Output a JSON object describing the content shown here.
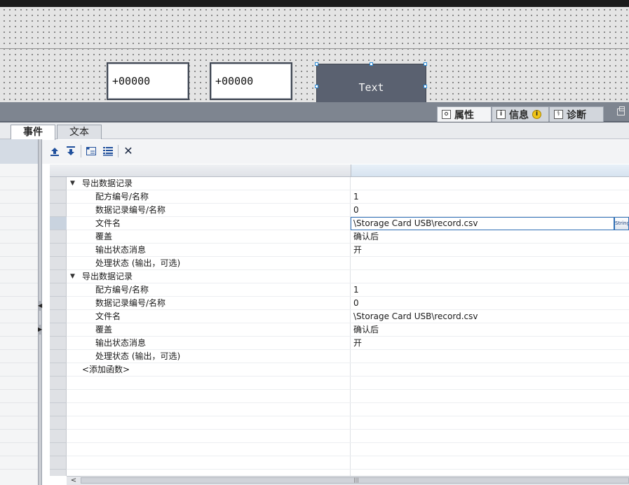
{
  "hmi_canvas": {
    "io_field_1_value": "+00000",
    "io_field_2_value": "+00000",
    "text_button_label": "Text"
  },
  "inspector_tabs": [
    {
      "label": "属性",
      "icon": "properties-icon",
      "active": true
    },
    {
      "label": "信息",
      "icon": "info-icon",
      "badge": "i"
    },
    {
      "label": "诊断",
      "icon": "diagnostics-icon"
    }
  ],
  "property_tabs": [
    {
      "label": "事件",
      "active": true
    },
    {
      "label": "文本"
    }
  ],
  "toolbar": {
    "buttons": [
      "move-up-icon",
      "move-down-icon",
      "insert-function-icon",
      "list-functions-icon",
      "delete-icon"
    ],
    "delete_glyph": "✕"
  },
  "functions": [
    {
      "name": "导出数据记录",
      "params": [
        {
          "name": "配方编号/名称",
          "value": "1"
        },
        {
          "name": "数据记录编号/名称",
          "value": "0"
        },
        {
          "name": "文件名",
          "value": "\\Storage Card USB\\record.csv",
          "editing": true
        },
        {
          "name": "覆盖",
          "value": "确认后"
        },
        {
          "name": "输出状态消息",
          "value": "开"
        },
        {
          "name": "处理状态 (输出，可选)",
          "value": ""
        }
      ]
    },
    {
      "name": "导出数据记录",
      "params": [
        {
          "name": "配方编号/名称",
          "value": "1"
        },
        {
          "name": "数据记录编号/名称",
          "value": "0"
        },
        {
          "name": "文件名",
          "value": "\\Storage Card USB\\record.csv"
        },
        {
          "name": "覆盖",
          "value": "确认后"
        },
        {
          "name": "输出状态消息",
          "value": "开"
        },
        {
          "name": "处理状态 (输出，可选)",
          "value": ""
        }
      ]
    }
  ],
  "add_function_label": "<添加函数>",
  "edit_button_label": "String",
  "colors": {
    "hmi_button": "#5a6170",
    "divider": "#7e8590",
    "selection_border": "#2f6fb5",
    "info_badge": "#f0c418"
  }
}
